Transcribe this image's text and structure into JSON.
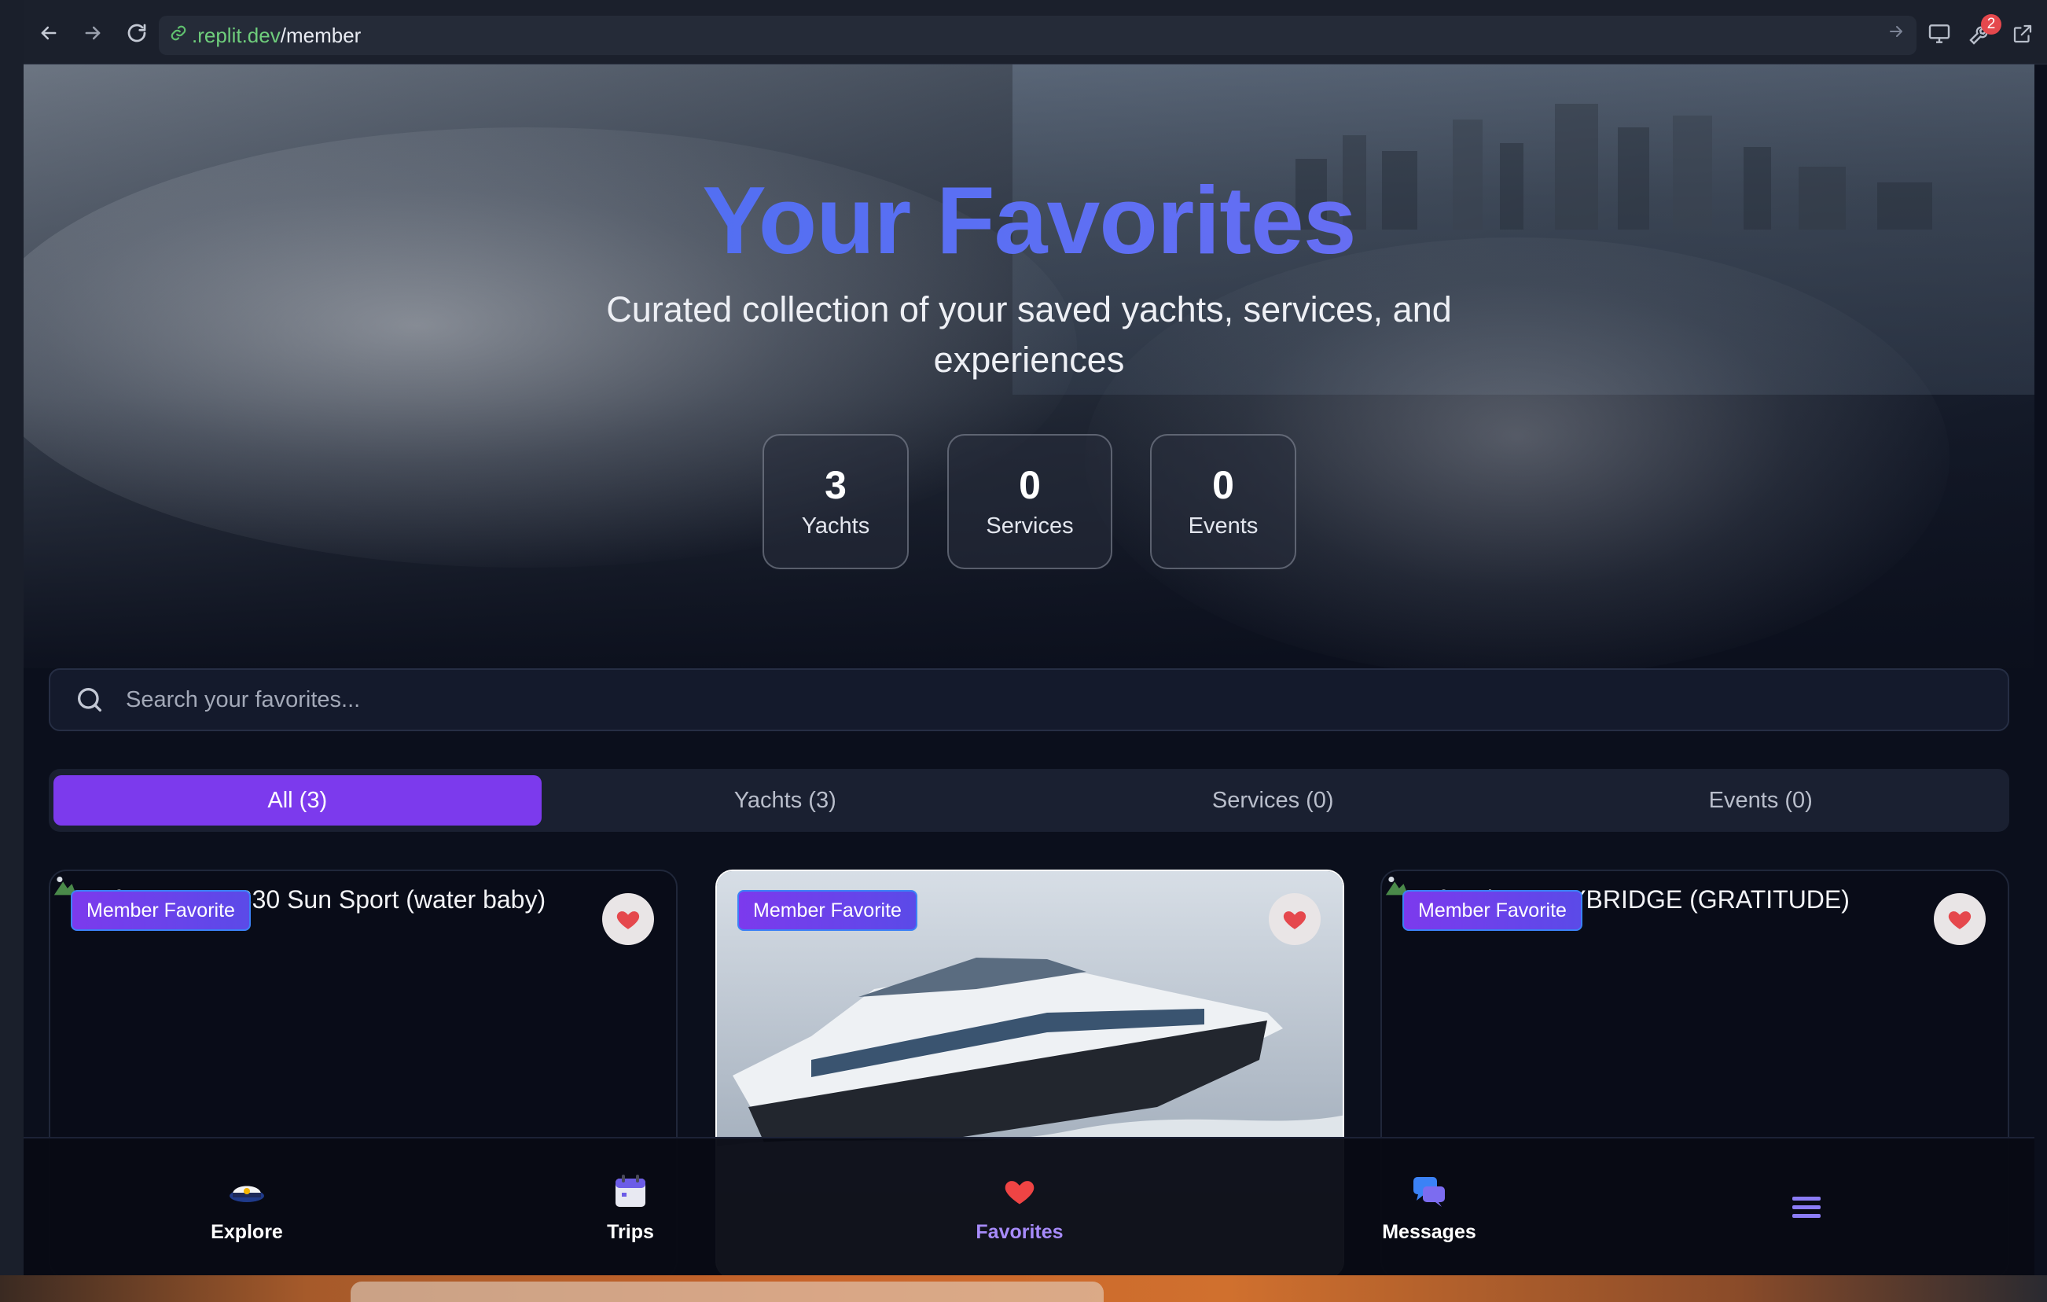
{
  "browser": {
    "url_domain": ".replit.dev",
    "url_path": "/member",
    "notification_count": "2"
  },
  "hero": {
    "title": "Your Favorites",
    "subtitle": "Curated collection of your saved yachts, services, and experiences",
    "stats": [
      {
        "value": "3",
        "label": "Yachts"
      },
      {
        "value": "0",
        "label": "Services"
      },
      {
        "value": "0",
        "label": "Events"
      }
    ]
  },
  "search": {
    "placeholder": "Search your favorites..."
  },
  "tabs": [
    {
      "label": "All (3)",
      "active": true
    },
    {
      "label": "Yachts (3)",
      "active": false
    },
    {
      "label": "Services (0)",
      "active": false
    },
    {
      "label": "Events (0)",
      "active": false
    }
  ],
  "cards": [
    {
      "alt_text": "63 ft Sea Ray 630 Sun Sport (water baby)",
      "badge": "Member Favorite",
      "image_loaded": false
    },
    {
      "alt_text": "",
      "badge": "Member Favorite",
      "image_loaded": true
    },
    {
      "alt_text": "74ft Azimut FLYBRIDGE (GRATITUDE)",
      "badge": "Member Favorite",
      "image_loaded": false
    }
  ],
  "bottom_nav": [
    {
      "label": "Explore",
      "icon": "captain-hat-icon",
      "active": false
    },
    {
      "label": "Trips",
      "icon": "calendar-icon",
      "active": false
    },
    {
      "label": "Favorites",
      "icon": "heart-icon",
      "active": true
    },
    {
      "label": "Messages",
      "icon": "chat-bubbles-icon",
      "active": false
    },
    {
      "label": "",
      "icon": "menu-icon",
      "active": false
    }
  ],
  "colors": {
    "accent": "#7c3aed",
    "active_nav": "#a78bfa",
    "heart": "#e5484d",
    "title_gradient_start": "#3f6ff0",
    "title_gradient_end": "#7b6cf2"
  }
}
